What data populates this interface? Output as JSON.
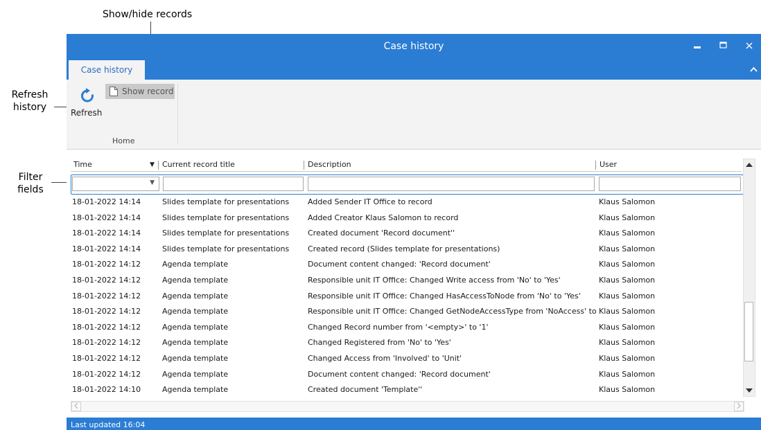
{
  "callouts": {
    "show_hide": "Show/hide records",
    "refresh_line1": "Refresh",
    "refresh_line2": "history",
    "filter_line1": "Filter",
    "filter_line2": "fields"
  },
  "window": {
    "title": "Case history",
    "minimize_glyph": "▬",
    "maximize_glyph": "☐",
    "close_glyph": "✕"
  },
  "ribbon": {
    "tab_label": "Case history",
    "collapse_glyph": "⌃",
    "refresh_label": "Refresh",
    "show_record_label": "Show record",
    "group_label": "Home"
  },
  "grid": {
    "columns": {
      "time": "Time",
      "title": "Current record title",
      "description": "Description",
      "user": "User"
    },
    "sort_glyph": "▼",
    "filter_dropdown_glyph": "▼",
    "rows": [
      {
        "time": "18-01-2022 14:14",
        "title": "Slides template for presentations",
        "description": "Added Sender IT Office to record",
        "user": "Klaus Salomon"
      },
      {
        "time": "18-01-2022 14:14",
        "title": "Slides template for presentations",
        "description": "Added Creator Klaus Salomon to record",
        "user": "Klaus Salomon"
      },
      {
        "time": "18-01-2022 14:14",
        "title": "Slides template for presentations",
        "description": "Created document 'Record document''",
        "user": "Klaus Salomon"
      },
      {
        "time": "18-01-2022 14:14",
        "title": "Slides template for presentations",
        "description": "Created record (Slides template for presentations)",
        "user": "Klaus Salomon"
      },
      {
        "time": "18-01-2022 14:12",
        "title": "Agenda template",
        "description": "Document content changed: 'Record document'",
        "user": "Klaus Salomon"
      },
      {
        "time": "18-01-2022 14:12",
        "title": "Agenda template",
        "description": "Responsible unit IT Office: Changed Write access from 'No' to 'Yes'",
        "user": "Klaus Salomon"
      },
      {
        "time": "18-01-2022 14:12",
        "title": "Agenda template",
        "description": "Responsible unit IT Office: Changed HasAccessToNode from 'No' to 'Yes'",
        "user": "Klaus Salomon"
      },
      {
        "time": "18-01-2022 14:12",
        "title": "Agenda template",
        "description": "Responsible unit IT Office: Changed GetNodeAccessType from 'NoAccess' to 'Wr...",
        "user": "Klaus Salomon"
      },
      {
        "time": "18-01-2022 14:12",
        "title": "Agenda template",
        "description": "Changed Record number from '<empty>' to '1'",
        "user": "Klaus Salomon"
      },
      {
        "time": "18-01-2022 14:12",
        "title": "Agenda template",
        "description": "Changed Registered from 'No' to 'Yes'",
        "user": "Klaus Salomon"
      },
      {
        "time": "18-01-2022 14:12",
        "title": "Agenda template",
        "description": "Changed Access from 'Involved' to 'Unit'",
        "user": "Klaus Salomon"
      },
      {
        "time": "18-01-2022 14:12",
        "title": "Agenda template",
        "description": "Document content changed: 'Record document'",
        "user": "Klaus Salomon"
      },
      {
        "time": "18-01-2022 14:10",
        "title": "Agenda template",
        "description": "Created document 'Template''",
        "user": "Klaus Salomon"
      }
    ]
  },
  "status": {
    "text": "Last updated 16:04"
  },
  "colors": {
    "accent": "#2b7cd3",
    "ribbon_bg": "#f3f3f3"
  }
}
